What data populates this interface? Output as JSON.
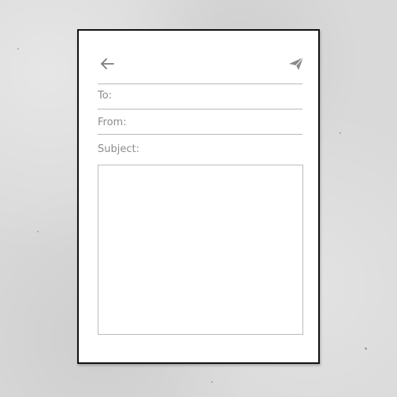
{
  "compose": {
    "to_label": "To:",
    "from_label": "From:",
    "subject_label": "Subject:",
    "to_value": "",
    "from_value": "",
    "subject_value": "",
    "message_body": ""
  },
  "toolbar": {
    "back_icon": "arrow-left-icon",
    "send_icon": "paper-plane-icon"
  },
  "colors": {
    "background": "#d9d9d9",
    "paper": "#ffffff",
    "paper_border": "#111111",
    "text": "#8c8c8c",
    "rule": "#b9b9b9",
    "icon": "#7a7a7a"
  }
}
